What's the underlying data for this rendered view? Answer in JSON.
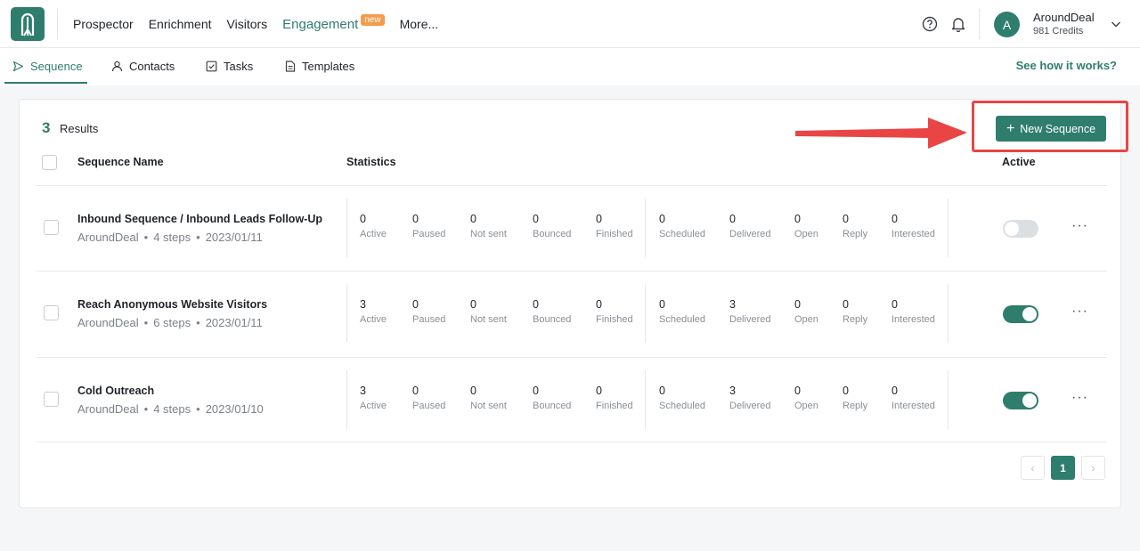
{
  "nav": {
    "links": [
      "Prospector",
      "Enrichment",
      "Visitors"
    ],
    "engagement": "Engagement",
    "badge": "new",
    "more": "More..."
  },
  "user": {
    "initial": "A",
    "name": "AroundDeal",
    "credits": "981 Credits"
  },
  "tabs": [
    {
      "label": "Sequence",
      "icon": "send-icon",
      "active": true
    },
    {
      "label": "Contacts",
      "icon": "person-icon"
    },
    {
      "label": "Tasks",
      "icon": "checkbox-icon"
    },
    {
      "label": "Templates",
      "icon": "document-icon"
    }
  ],
  "see_how": "See how it works?",
  "results": {
    "count": "3",
    "label": "Results"
  },
  "new_sequence_label": "New Sequence",
  "columns": {
    "name": "Sequence Name",
    "statistics": "Statistics",
    "active": "Active"
  },
  "stat_labels": [
    "Active",
    "Paused",
    "Not sent",
    "Bounced",
    "Finished",
    "Scheduled",
    "Delivered",
    "Open",
    "Reply",
    "Interested"
  ],
  "rows": [
    {
      "name": "Inbound Sequence / Inbound Leads Follow-Up",
      "owner": "AroundDeal",
      "steps": "4 steps",
      "date": "2023/01/11",
      "stats": [
        "0",
        "0",
        "0",
        "0",
        "0",
        "0",
        "0",
        "0",
        "0",
        "0"
      ],
      "active": false
    },
    {
      "name": "Reach Anonymous Website Visitors",
      "owner": "AroundDeal",
      "steps": "6 steps",
      "date": "2023/01/11",
      "stats": [
        "3",
        "0",
        "0",
        "0",
        "0",
        "0",
        "3",
        "0",
        "0",
        "0"
      ],
      "active": true
    },
    {
      "name": "Cold Outreach",
      "owner": "AroundDeal",
      "steps": "4 steps",
      "date": "2023/01/10",
      "stats": [
        "3",
        "0",
        "0",
        "0",
        "0",
        "0",
        "3",
        "0",
        "0",
        "0"
      ],
      "active": true
    }
  ],
  "pagination": {
    "prev": "‹",
    "current": "1",
    "next": "›"
  },
  "colors": {
    "brand": "#2f7d6d",
    "badge": "#f39c4a",
    "highlight": "#e94545"
  }
}
